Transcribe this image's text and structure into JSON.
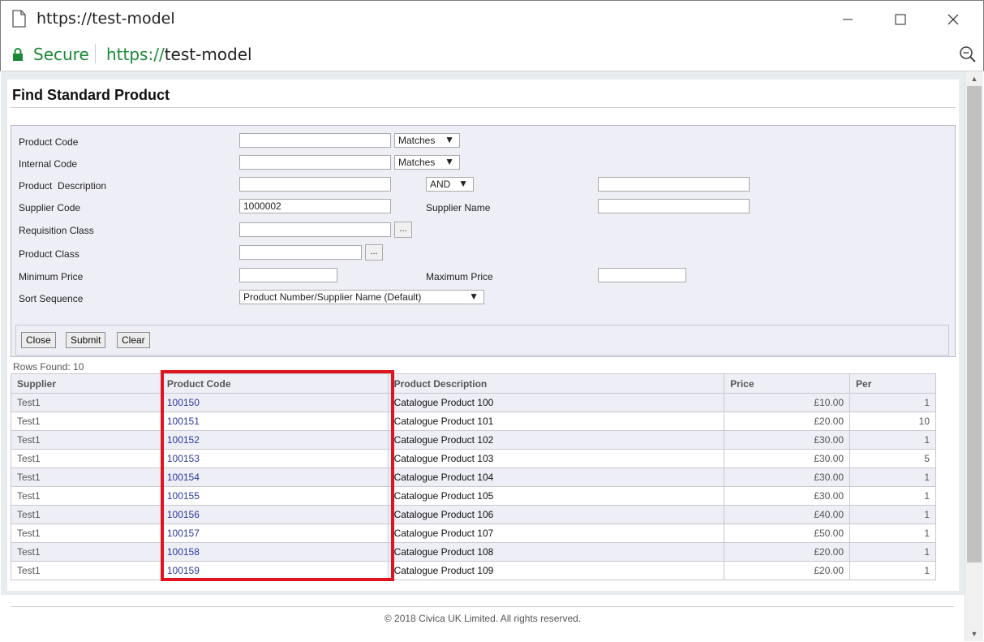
{
  "window": {
    "title": "https://test-model",
    "doc_icon": "document-icon",
    "minimize_icon": "minimize-icon",
    "maximize_icon": "maximize-icon",
    "close_icon": "close-icon"
  },
  "address_bar": {
    "secure_label": "Secure",
    "url_scheme": "https://",
    "url_host": "test-model",
    "lock_icon": "lock-icon",
    "zoom_icon": "zoom-icon"
  },
  "page": {
    "title": "Find Standard Product"
  },
  "form": {
    "product_code": {
      "label": "Product Code",
      "value": "",
      "match_mode": "Matches"
    },
    "internal_code": {
      "label": "Internal Code",
      "value": "",
      "match_mode": "Matches"
    },
    "product_description": {
      "label": "Product  Description",
      "value": "",
      "operator": "AND",
      "value2": ""
    },
    "supplier_code": {
      "label": "Supplier Code",
      "value": "1000002"
    },
    "supplier_name": {
      "label": "Supplier Name",
      "value": ""
    },
    "requisition_class": {
      "label": "Requisition Class",
      "value": "",
      "lookup_label": "..."
    },
    "product_class": {
      "label": "Product Class",
      "value": "",
      "lookup_label": "..."
    },
    "minimum_price": {
      "label": "Minimum Price",
      "value": ""
    },
    "maximum_price": {
      "label": "Maximum Price",
      "value": ""
    },
    "sort_sequence": {
      "label": "Sort Sequence",
      "value": "Product Number/Supplier Name (Default)"
    }
  },
  "buttons": {
    "close": "Close",
    "submit": "Submit",
    "clear": "Clear"
  },
  "results": {
    "rows_found": "Rows Found: 10",
    "columns": [
      "Supplier",
      "Product Code",
      "Product Description",
      "Price",
      "Per"
    ],
    "rows": [
      {
        "supplier": "Test1",
        "code": "100150",
        "description": "Catalogue Product 100",
        "price": "£10.00",
        "per": "1"
      },
      {
        "supplier": "Test1",
        "code": "100151",
        "description": "Catalogue Product 101",
        "price": "£20.00",
        "per": "10"
      },
      {
        "supplier": "Test1",
        "code": "100152",
        "description": "Catalogue Product 102",
        "price": "£30.00",
        "per": "1"
      },
      {
        "supplier": "Test1",
        "code": "100153",
        "description": "Catalogue Product 103",
        "price": "£30.00",
        "per": "5"
      },
      {
        "supplier": "Test1",
        "code": "100154",
        "description": "Catalogue Product 104",
        "price": "£30.00",
        "per": "1"
      },
      {
        "supplier": "Test1",
        "code": "100155",
        "description": "Catalogue Product 105",
        "price": "£30.00",
        "per": "1"
      },
      {
        "supplier": "Test1",
        "code": "100156",
        "description": "Catalogue Product 106",
        "price": "£40.00",
        "per": "1"
      },
      {
        "supplier": "Test1",
        "code": "100157",
        "description": "Catalogue Product 107",
        "price": "£50.00",
        "per": "1"
      },
      {
        "supplier": "Test1",
        "code": "100158",
        "description": "Catalogue Product 108",
        "price": "£20.00",
        "per": "1"
      },
      {
        "supplier": "Test1",
        "code": "100159",
        "description": "Catalogue Product 109",
        "price": "£20.00",
        "per": "1"
      }
    ]
  },
  "footer": {
    "copyright": "© 2018 Civica UK Limited. All rights reserved."
  },
  "colors": {
    "secure_green": "#1a8a37",
    "highlight_red": "#e0141e",
    "link_blue": "#2b3a9a",
    "row_alt": "#eeeef7"
  }
}
